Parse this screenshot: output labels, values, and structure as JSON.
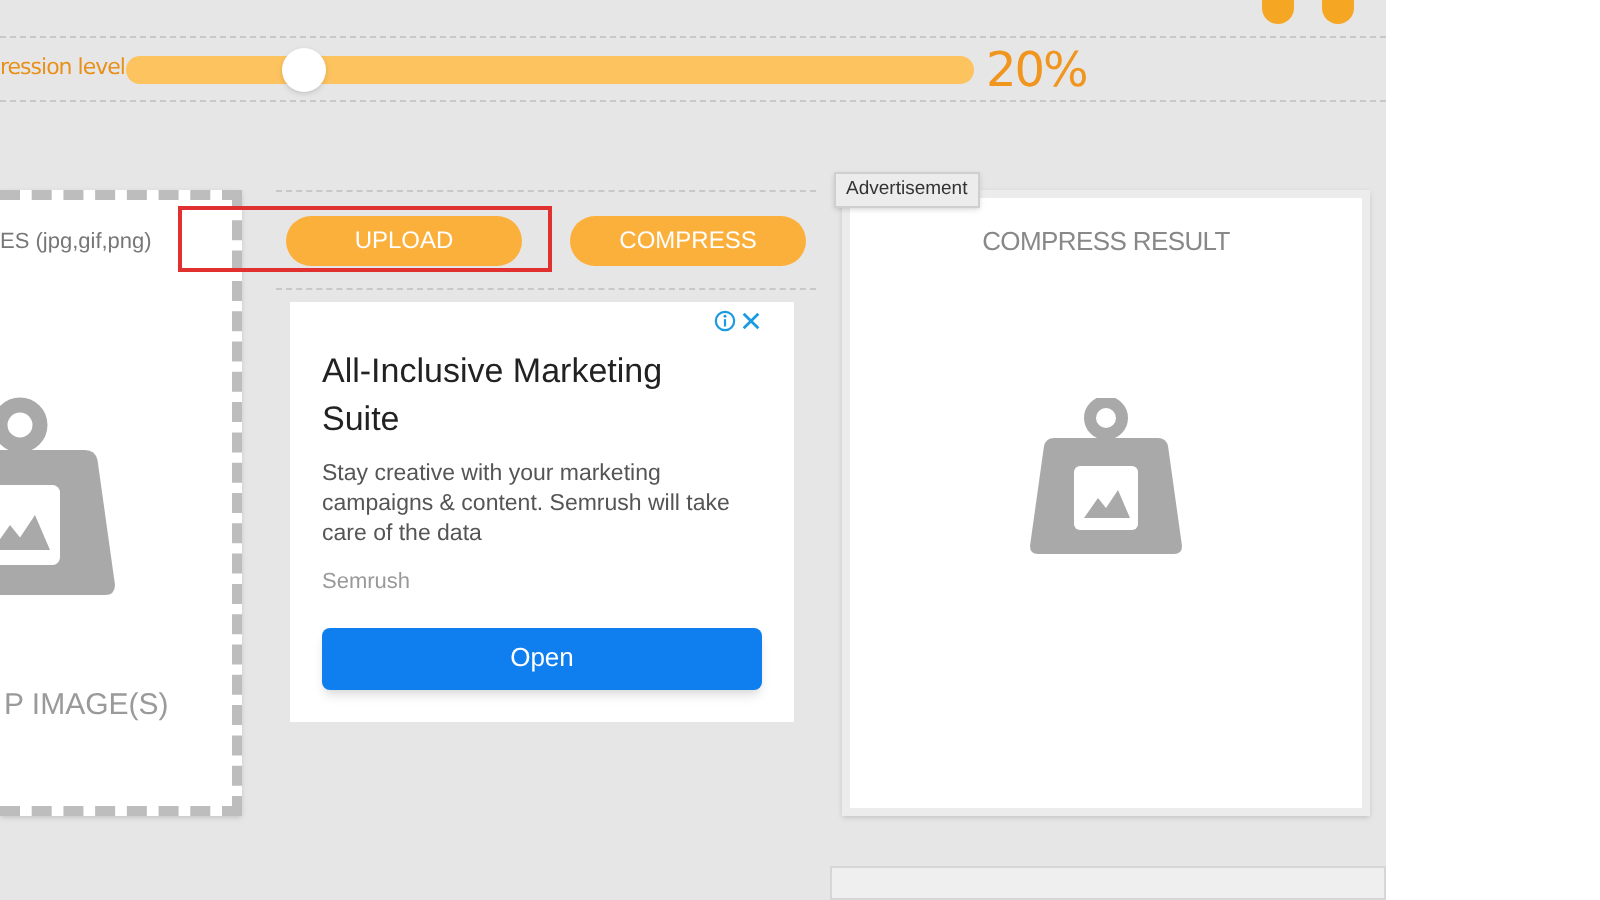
{
  "compression": {
    "label": "ression level",
    "level": 0.21,
    "reading": "20%"
  },
  "drop_zone": {
    "hint": "ES (jpg,gif,png)",
    "caption": "P IMAGE(S)"
  },
  "buttons": [
    {
      "label": "UPLOAD",
      "highlighted": true
    },
    {
      "label": "COMPRESS",
      "highlighted": false
    }
  ],
  "ad": {
    "title": "All-Inclusive Marketing Suite",
    "body": "Stay creative with your marketing campaigns & content. Semrush will take care of the data",
    "advertiser": "Semrush",
    "cta": "Open"
  },
  "result": {
    "tooltip": "Advertisement",
    "title": "COMPRESS RESULT"
  }
}
